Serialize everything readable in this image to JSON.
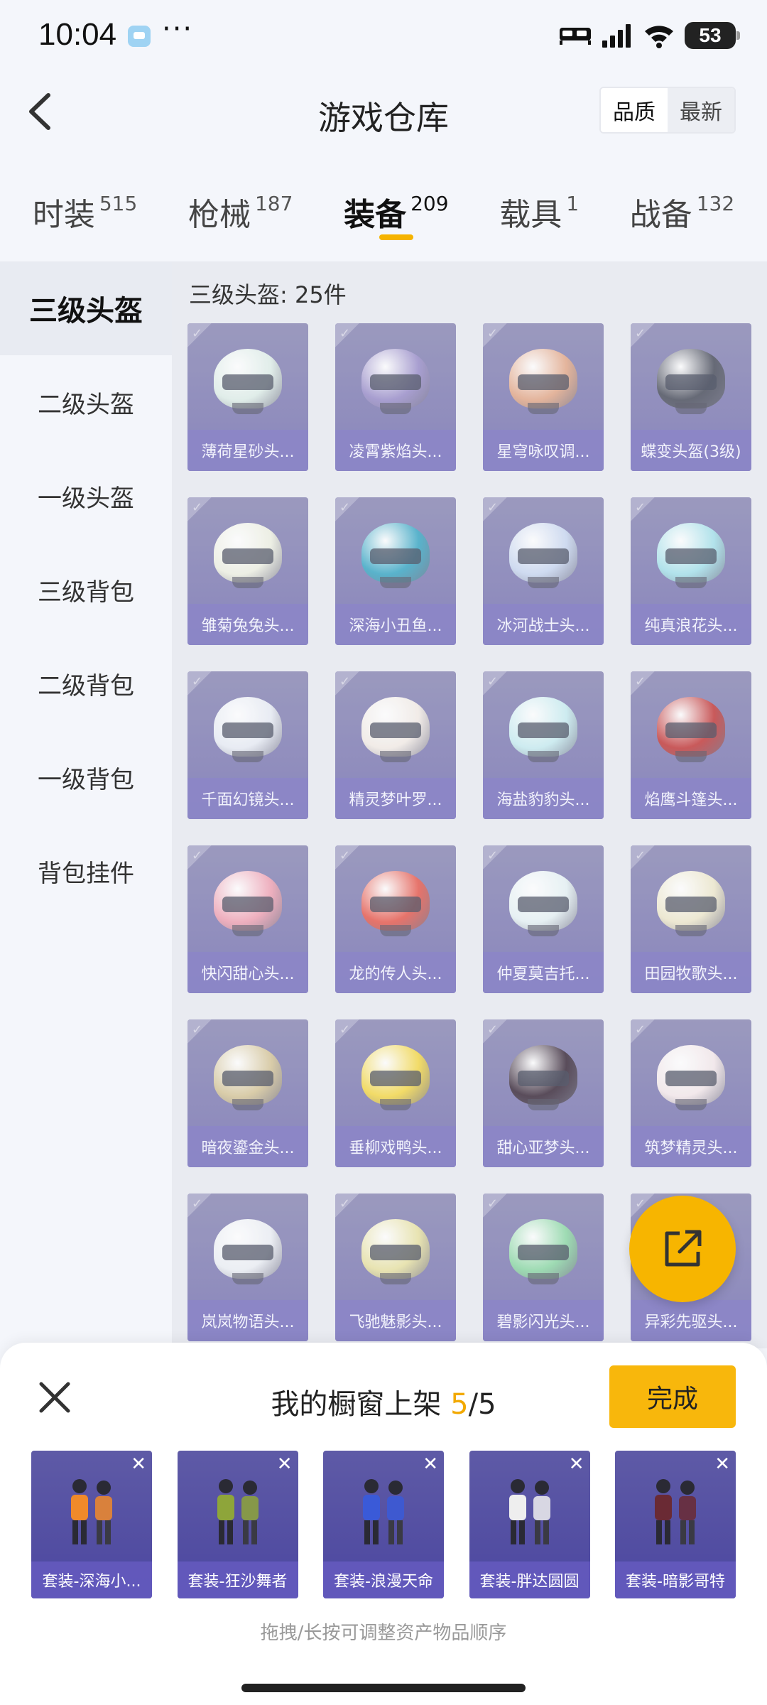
{
  "status_bar": {
    "time": "10:04",
    "more": "···",
    "battery": "53"
  },
  "header": {
    "title": "游戏仓库",
    "sort_options": [
      "品质",
      "最新"
    ]
  },
  "tabs": [
    {
      "label": "时装",
      "count": "515"
    },
    {
      "label": "枪械",
      "count": "187"
    },
    {
      "label": "装备",
      "count": "209"
    },
    {
      "label": "载具",
      "count": "1"
    },
    {
      "label": "战备",
      "count": "132"
    }
  ],
  "sidebar": {
    "items": [
      "三级头盔",
      "二级头盔",
      "一级头盔",
      "三级背包",
      "二级背包",
      "一级背包",
      "背包挂件"
    ]
  },
  "content": {
    "section_title": "三级头盔: 25件",
    "items": [
      {
        "label": "薄荷星砂头...",
        "color": "#dfeee8"
      },
      {
        "label": "凌霄紫焰头...",
        "color": "#9a8ec9"
      },
      {
        "label": "星穹咏叹调...",
        "color": "#e3a98a"
      },
      {
        "label": "蝶变头盔(3级)",
        "color": "#4a4e5c"
      },
      {
        "label": "雏菊兔兔头...",
        "color": "#eef0e2"
      },
      {
        "label": "深海小丑鱼...",
        "color": "#3aa7c4"
      },
      {
        "label": "冰河战士头...",
        "color": "#c9d7f0"
      },
      {
        "label": "纯真浪花头...",
        "color": "#a6e1ea"
      },
      {
        "label": "千面幻镜头...",
        "color": "#e8ecf4"
      },
      {
        "label": "精灵梦叶罗...",
        "color": "#f3ece6"
      },
      {
        "label": "海盐豹豹头...",
        "color": "#c8ecf0"
      },
      {
        "label": "焰鹰斗篷头...",
        "color": "#c23a3a"
      },
      {
        "label": "快闪甜心头...",
        "color": "#f0a3b4"
      },
      {
        "label": "龙的传人头...",
        "color": "#e65a4e"
      },
      {
        "label": "仲夏莫吉托...",
        "color": "#e6f2f4"
      },
      {
        "label": "田园牧歌头...",
        "color": "#eee8cc"
      },
      {
        "label": "暗夜鎏金头...",
        "color": "#d6c69a"
      },
      {
        "label": "垂柳戏鸭头...",
        "color": "#f4d84a"
      },
      {
        "label": "甜心亚梦头...",
        "color": "#3a2a3a"
      },
      {
        "label": "筑梦精灵头...",
        "color": "#f4e8ea"
      },
      {
        "label": "岚岚物语头...",
        "color": "#eceff4"
      },
      {
        "label": "飞驰魅影头...",
        "color": "#e8e2a4"
      },
      {
        "label": "碧影闪光头...",
        "color": "#8ed8a6"
      },
      {
        "label": "异彩先驱头...",
        "color": "#d9c9e8"
      }
    ]
  },
  "share_button": {
    "icon": "share-icon"
  },
  "showcase_panel": {
    "title": "我的橱窗上架",
    "current": "5",
    "separator": "/",
    "total": "5",
    "done_label": "完成",
    "items": [
      {
        "label": "套装-深海小...",
        "color": "#f08a2a"
      },
      {
        "label": "套装-狂沙舞者",
        "color": "#8ea53a"
      },
      {
        "label": "套装-浪漫天命",
        "color": "#3a5ad8"
      },
      {
        "label": "套装-胖达圆圆",
        "color": "#eeeeee"
      },
      {
        "label": "套装-暗影哥特",
        "color": "#6a2a34"
      }
    ],
    "hint": "拖拽/长按可调整资产物品顺序"
  },
  "colors": {
    "accent": "#f8b70c",
    "card": "#7c78b2",
    "background": "#f4f6fb"
  }
}
